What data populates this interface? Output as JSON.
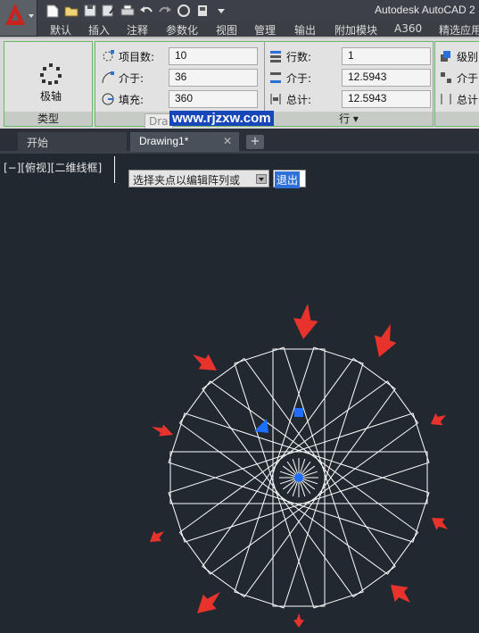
{
  "title": "Autodesk AutoCAD 2",
  "ribbon_tabs": [
    "默认",
    "插入",
    "注释",
    "参数化",
    "视图",
    "管理",
    "输出",
    "附加模块",
    "A360",
    "精选应用"
  ],
  "type_panel": {
    "button_label": "极轴",
    "footer": "类型"
  },
  "items_panel": {
    "items_label": "项目数:",
    "items_value": "10",
    "between_label": "介于:",
    "between_value": "36",
    "fill_label": "填充:",
    "fill_value": "360"
  },
  "rows_panel": {
    "rows_label": "行数:",
    "rows_value": "1",
    "between_label": "介于:",
    "between_value": "12.5943",
    "total_label": "总计:",
    "total_value": "12.5943",
    "footer": "行 ▾"
  },
  "levels_panel": {
    "levels_label": "级别",
    "between_label": "介于",
    "total_label": "总计"
  },
  "tooltip_tag": "Dra",
  "watermark": "www.rjzxw.com",
  "doc_tabs": {
    "start": "开始",
    "drawing": "Drawing1*",
    "close": "✕",
    "add": "+"
  },
  "viewport_label": "[−][俯视][二维线框]",
  "command_prompt": "选择夹点以编辑阵列或",
  "exit_option": "退出",
  "colors": {
    "ribbon_bg": "#d8d8d8",
    "canvas_bg": "#212830",
    "grip": "#1e6fff",
    "arrow": "#e8322c",
    "geometry": "#ffffff"
  },
  "icons": [
    "autocad-logo-icon",
    "new-icon",
    "open-icon",
    "save-icon",
    "saveas-icon",
    "print-icon",
    "undo-icon",
    "redo-icon",
    "share-icon",
    "workspace-icon",
    "polar-array-icon",
    "items-icon",
    "angle-icon",
    "fill-icon",
    "rows-icon",
    "levels-icon"
  ]
}
